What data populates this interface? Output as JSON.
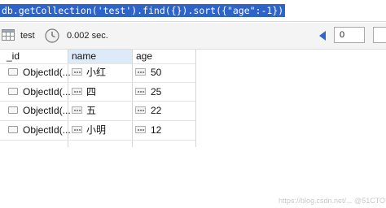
{
  "query": {
    "text": "db.getCollection('test').find({}).sort({\"age\":-1})"
  },
  "toolbar": {
    "collection": "test",
    "time": "0.002 sec.",
    "skip_value": "0",
    "grid_icon": "grid-table-icon",
    "clock_icon": "clock-icon",
    "prev_icon": "triangle-left-icon"
  },
  "table": {
    "columns": [
      "_id",
      "name",
      "age"
    ],
    "rows": [
      {
        "id": "ObjectId(...",
        "name": "小红",
        "age": "50"
      },
      {
        "id": "ObjectId(...",
        "name": "四",
        "age": "25"
      },
      {
        "id": "ObjectId(...",
        "name": "五",
        "age": "22"
      },
      {
        "id": "ObjectId(...",
        "name": "小明",
        "age": "12"
      }
    ]
  },
  "watermark": "https://blog.csdn.net/... @51CTO博客",
  "colors": {
    "selection": "#2e63c8",
    "header_highlight": "#ddeaf8",
    "prev_arrow": "#2f66c8"
  }
}
